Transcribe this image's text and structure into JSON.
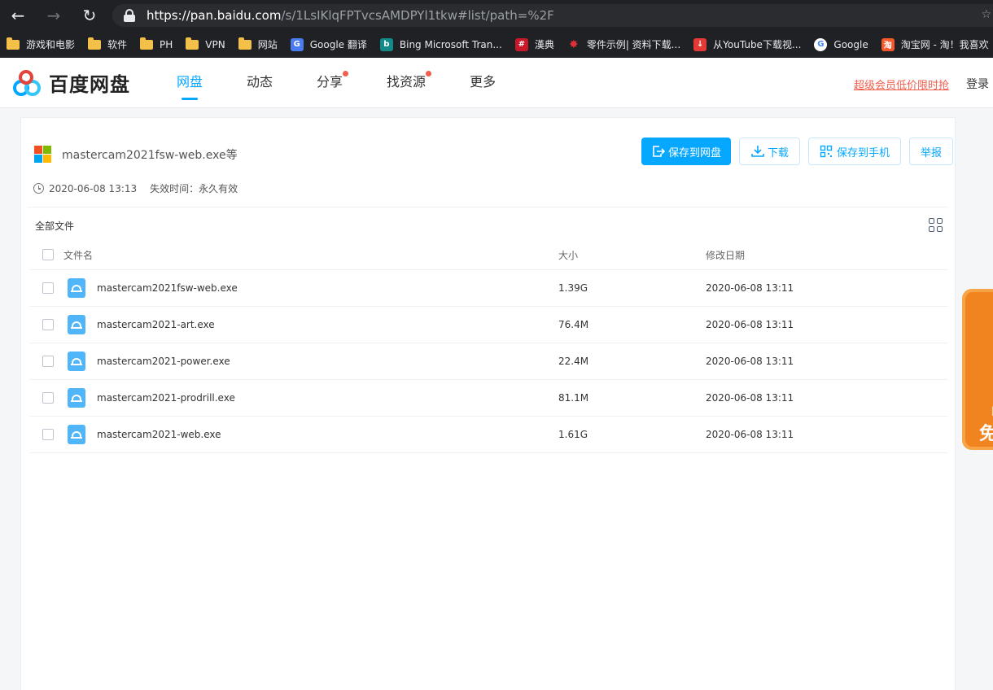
{
  "browser": {
    "url_host": "https://pan.baidu.com",
    "url_path": "/s/1LsIKlqFPTvcsAMDPYl1tkw#list/path=%2F",
    "bookmarks": [
      {
        "label": "游戏和电影",
        "kind": "folder"
      },
      {
        "label": "软件",
        "kind": "folder"
      },
      {
        "label": "PH",
        "kind": "folder"
      },
      {
        "label": "VPN",
        "kind": "folder"
      },
      {
        "label": "网站",
        "kind": "folder"
      },
      {
        "label": "Google 翻译",
        "kind": "google-translate-icon"
      },
      {
        "label": "Bing Microsoft Tran...",
        "kind": "bing-icon"
      },
      {
        "label": "漢典",
        "kind": "zdic-icon"
      },
      {
        "label": "零件示例| 资料下载...",
        "kind": "parts-icon"
      },
      {
        "label": "从YouTube下载视...",
        "kind": "download-icon"
      },
      {
        "label": "Google",
        "kind": "google-icon"
      },
      {
        "label": "淘宝网 - 淘！我喜欢",
        "kind": "taobao-icon"
      }
    ]
  },
  "header": {
    "logo_text": "百度网盘",
    "nav": [
      {
        "label": "网盘",
        "active": true,
        "dot": false
      },
      {
        "label": "动态",
        "active": false,
        "dot": false
      },
      {
        "label": "分享",
        "active": false,
        "dot": true
      },
      {
        "label": "找资源",
        "active": false,
        "dot": true
      },
      {
        "label": "更多",
        "active": false,
        "dot": false
      }
    ],
    "promo": "超级会员低价限时抢",
    "login": "登录"
  },
  "share": {
    "title": "mastercam2021fsw-web.exe等",
    "created": "2020-06-08 13:13",
    "expire": "失效时间：永久有效",
    "actions": {
      "save": "保存到网盘",
      "download": "下载",
      "save_phone": "保存到手机",
      "report": "举报"
    },
    "all_files": "全部文件"
  },
  "table": {
    "headers": {
      "name": "文件名",
      "size": "大小",
      "date": "修改日期"
    },
    "rows": [
      {
        "name": "mastercam2021fsw-web.exe",
        "size": "1.39G",
        "date": "2020-06-08 13:11"
      },
      {
        "name": "mastercam2021-art.exe",
        "size": "76.4M",
        "date": "2020-06-08 13:11"
      },
      {
        "name": "mastercam2021-power.exe",
        "size": "22.4M",
        "date": "2020-06-08 13:11"
      },
      {
        "name": "mastercam2021-prodrill.exe",
        "size": "81.1M",
        "date": "2020-06-08 13:11"
      },
      {
        "name": "mastercam2021-web.exe",
        "size": "1.61G",
        "date": "2020-06-08 13:11"
      }
    ]
  },
  "side_ad": {
    "line1": "网",
    "line2": "免"
  },
  "colors": {
    "accent": "#06a7ff",
    "promo": "#f25d4c",
    "ad": "#f28420"
  }
}
